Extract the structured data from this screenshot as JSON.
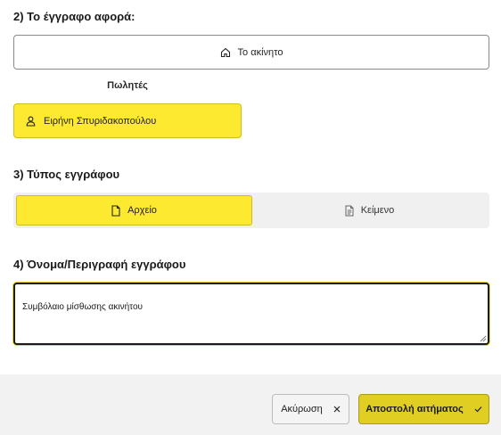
{
  "section2": {
    "title": "2) Το έγγραφο αφορά:",
    "property_label": "Το ακίνητο",
    "property_icon": "home-icon",
    "sellers_label": "Πωλητές",
    "seller_name": "Ειρήνη Σπυριδακοπούλου",
    "seller_icon": "user-icon"
  },
  "section3": {
    "title": "3) Τύπος εγγράφου",
    "options": [
      {
        "label": "Αρχείο",
        "icon": "file-icon",
        "selected": true
      },
      {
        "label": "Κείμενο",
        "icon": "text-document-icon",
        "selected": false
      }
    ]
  },
  "section4": {
    "title": "4) Όνομα/Περιγραφή εγγράφου",
    "value": "Συμβόλαιο μίσθωσης ακινήτου"
  },
  "footer": {
    "cancel_label": "Ακύρωση",
    "cancel_icon": "close-icon",
    "submit_label": "Αποστολή αιτήματος",
    "submit_icon": "check-icon"
  },
  "colors": {
    "accent_yellow": "#fde92f",
    "submit_yellow": "#e0cf22",
    "footer_bg": "#f2f2f2"
  }
}
